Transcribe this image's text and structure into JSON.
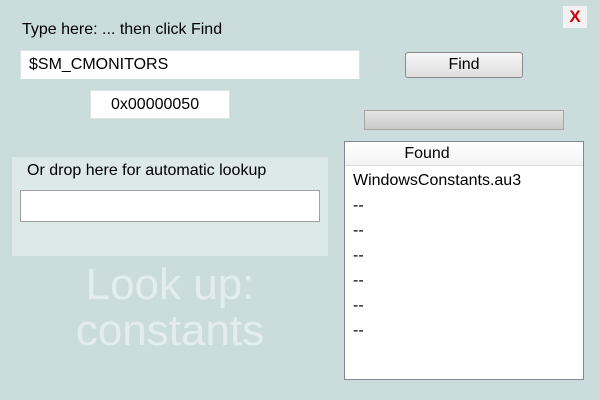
{
  "window": {
    "close_label": "X"
  },
  "search": {
    "prompt": "Type here:  ... then click Find",
    "value": "$SM_CMONITORS"
  },
  "find_button": {
    "label": "Find"
  },
  "result": {
    "value": "0x00000050"
  },
  "progress": {
    "value": 0
  },
  "drop": {
    "label": "Or drop here for automatic lookup",
    "value": ""
  },
  "watermark": {
    "line1": "Look up:",
    "line2": "constants"
  },
  "found_list": {
    "header": "Found",
    "items": [
      "WindowsConstants.au3",
      "--",
      "--",
      "--",
      "--",
      "--",
      "--"
    ]
  },
  "colors": {
    "background": "#cbdcdc",
    "close": "#cc0000",
    "panel": "#dce9e6"
  }
}
